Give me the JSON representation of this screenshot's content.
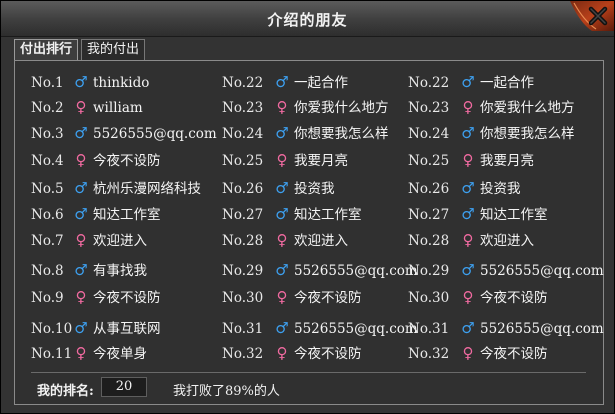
{
  "window": {
    "title": "介绍的朋友"
  },
  "tabs": [
    {
      "label": "付出排行",
      "active": true
    },
    {
      "label": "我的付出",
      "active": false
    }
  ],
  "ranking": {
    "columns": [
      [
        {
          "rank": "No.1",
          "gender": "male",
          "name": "thinkido"
        },
        {
          "rank": "No.2",
          "gender": "female",
          "name": "william"
        },
        {
          "rank": "No.3",
          "gender": "male",
          "name": "5526555@qq.com"
        },
        {
          "rank": "No.4",
          "gender": "female",
          "name": "今夜不设防"
        },
        {
          "rank": "No.5",
          "gender": "male",
          "name": "杭州乐漫网络科技"
        },
        {
          "rank": "No.6",
          "gender": "male",
          "name": "知达工作室"
        },
        {
          "rank": "No.7",
          "gender": "female",
          "name": "欢迎进入"
        },
        {
          "rank": "No.8",
          "gender": "male",
          "name": "有事找我"
        },
        {
          "rank": "No.9",
          "gender": "female",
          "name": "今夜不设防"
        },
        {
          "rank": "No.10",
          "gender": "male",
          "name": "从事互联网"
        },
        {
          "rank": "No.11",
          "gender": "female",
          "name": "今夜单身"
        }
      ],
      [
        {
          "rank": "No.22",
          "gender": "male",
          "name": "一起合作"
        },
        {
          "rank": "No.23",
          "gender": "female",
          "name": "你爱我什么地方"
        },
        {
          "rank": "No.24",
          "gender": "male",
          "name": "你想要我怎么样"
        },
        {
          "rank": "No.25",
          "gender": "female",
          "name": "我要月亮"
        },
        {
          "rank": "No.26",
          "gender": "male",
          "name": "投资我"
        },
        {
          "rank": "No.27",
          "gender": "male",
          "name": "知达工作室"
        },
        {
          "rank": "No.28",
          "gender": "female",
          "name": "欢迎进入"
        },
        {
          "rank": "No.29",
          "gender": "male",
          "name": "5526555@qq.com"
        },
        {
          "rank": "No.30",
          "gender": "female",
          "name": "今夜不设防"
        },
        {
          "rank": "No.31",
          "gender": "male",
          "name": "5526555@qq.com"
        },
        {
          "rank": "No.32",
          "gender": "female",
          "name": "今夜不设防"
        }
      ],
      [
        {
          "rank": "No.22",
          "gender": "male",
          "name": "一起合作"
        },
        {
          "rank": "No.23",
          "gender": "female",
          "name": "你爱我什么地方"
        },
        {
          "rank": "No.24",
          "gender": "male",
          "name": "你想要我怎么样"
        },
        {
          "rank": "No.25",
          "gender": "female",
          "name": "我要月亮"
        },
        {
          "rank": "No.26",
          "gender": "male",
          "name": "投资我"
        },
        {
          "rank": "No.27",
          "gender": "male",
          "name": "知达工作室"
        },
        {
          "rank": "No.28",
          "gender": "female",
          "name": "欢迎进入"
        },
        {
          "rank": "No.29",
          "gender": "male",
          "name": "5526555@qq.com"
        },
        {
          "rank": "No.30",
          "gender": "female",
          "name": "今夜不设防"
        },
        {
          "rank": "No.31",
          "gender": "male",
          "name": "5526555@qq.com"
        },
        {
          "rank": "No.32",
          "gender": "female",
          "name": "今夜不设防"
        }
      ]
    ]
  },
  "gender_icons": {
    "male": "♂",
    "female": "♀"
  },
  "colors": {
    "male": "#3da0f0",
    "female": "#f06aa0"
  },
  "footer": {
    "my_rank_label": "我的排名:",
    "my_rank_value": "20",
    "beat_text": "我打败了89%的人"
  }
}
